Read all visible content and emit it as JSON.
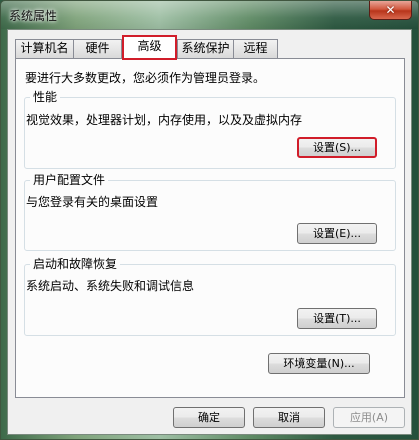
{
  "window": {
    "title": "系统属性",
    "close_symbol": "✕"
  },
  "tabs": [
    {
      "label": "计算机名"
    },
    {
      "label": "硬件"
    },
    {
      "label": "高级",
      "selected": true
    },
    {
      "label": "系统保护"
    },
    {
      "label": "远程"
    }
  ],
  "main": {
    "admin_note": "要进行大多数更改，您必须作为管理员登录。",
    "performance": {
      "title": "性能",
      "description": "视觉效果，处理器计划，内存使用，以及及虚拟内存",
      "button": "设置(S)..."
    },
    "user_profiles": {
      "title": "用户配置文件",
      "description": "与您登录有关的桌面设置",
      "button": "设置(E)..."
    },
    "startup_recovery": {
      "title": "启动和故障恢复",
      "description": "系统启动、系统失败和调试信息",
      "button": "设置(T)..."
    },
    "env_button": "环境变量(N)..."
  },
  "footer": {
    "ok": "确定",
    "cancel": "取消",
    "apply": "应用(A)"
  },
  "colors": {
    "highlight_border": "#d11d2a",
    "dialog_background": "#f0f0f0"
  }
}
